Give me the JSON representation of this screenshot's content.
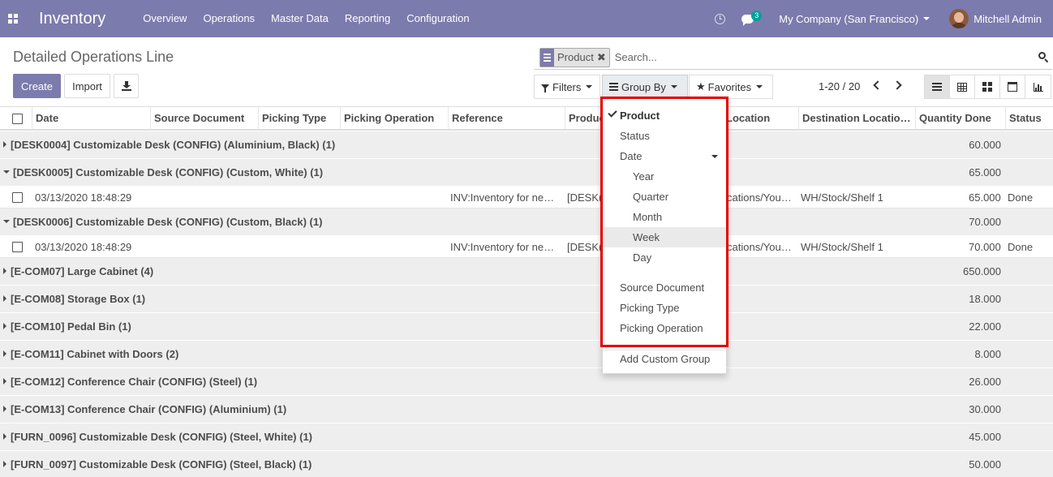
{
  "navbar": {
    "app_title": "Inventory",
    "menu": [
      "Overview",
      "Operations",
      "Master Data",
      "Reporting",
      "Configuration"
    ],
    "chat_badge": "3",
    "company": "My Company (San Francisco)",
    "user": "Mitchell Admin"
  },
  "page": {
    "title": "Detailed Operations Line",
    "create_label": "Create",
    "import_label": "Import"
  },
  "search": {
    "facet_label": "Product",
    "facet_close": "✖",
    "placeholder": "Search..."
  },
  "search_buttons": {
    "filters": "Filters",
    "group_by": "Group By",
    "favorites": "Favorites"
  },
  "pager": {
    "text": "1-20 / 20"
  },
  "table": {
    "columns": [
      "Date",
      "Source Document",
      "Picking Type",
      "Picking Operation",
      "Reference",
      "Product",
      "Location",
      "Destination Locatio…",
      "Quantity Done",
      "Status"
    ],
    "groups": [
      {
        "label": "[DESK0004] Customizable Desk (CONFIG) (Aluminium, Black) (1)",
        "qty": "60.000",
        "open": false
      },
      {
        "label": "[DESK0005] Customizable Desk (CONFIG) (Custom, White) (1)",
        "qty": "65.000",
        "open": true,
        "row": {
          "date": "03/13/2020 18:48:29",
          "reference": "INV:Inventory for ne…",
          "product": "[DESK(",
          "location": "cations/You…",
          "destination": "WH/Stock/Shelf 1",
          "qty": "65.000",
          "status": "Done"
        }
      },
      {
        "label": "[DESK0006] Customizable Desk (CONFIG) (Custom, Black) (1)",
        "qty": "70.000",
        "open": true,
        "row": {
          "date": "03/13/2020 18:48:29",
          "reference": "INV:Inventory for ne…",
          "product": "[DESK(",
          "location": "cations/You…",
          "destination": "WH/Stock/Shelf 1",
          "qty": "70.000",
          "status": "Done"
        }
      },
      {
        "label": "[E-COM07] Large Cabinet (4)",
        "qty": "650.000",
        "open": false
      },
      {
        "label": "[E-COM08] Storage Box (1)",
        "qty": "18.000",
        "open": false
      },
      {
        "label": "[E-COM10] Pedal Bin (1)",
        "qty": "22.000",
        "open": false
      },
      {
        "label": "[E-COM11] Cabinet with Doors (2)",
        "qty": "8.000",
        "open": false
      },
      {
        "label": "[E-COM12] Conference Chair (CONFIG) (Steel) (1)",
        "qty": "26.000",
        "open": false
      },
      {
        "label": "[E-COM13] Conference Chair (CONFIG) (Aluminium) (1)",
        "qty": "30.000",
        "open": false
      },
      {
        "label": "[FURN_0096] Customizable Desk (CONFIG) (Steel, White) (1)",
        "qty": "45.000",
        "open": false
      },
      {
        "label": "[FURN_0097] Customizable Desk (CONFIG) (Steel, Black) (1)",
        "qty": "50.000",
        "open": false
      }
    ]
  },
  "groupby_menu": {
    "items": [
      {
        "label": "Product",
        "selected": true
      },
      {
        "label": "Status"
      },
      {
        "label": "Date",
        "has_caret": true
      },
      {
        "label": "Year",
        "sub": true
      },
      {
        "label": "Quarter",
        "sub": true
      },
      {
        "label": "Month",
        "sub": true
      },
      {
        "label": "Week",
        "sub": true,
        "hover": true
      },
      {
        "label": "Day",
        "sub": true
      },
      {
        "label": "Source Document"
      },
      {
        "label": "Picking Type"
      },
      {
        "label": "Picking Operation"
      }
    ],
    "custom_group": "Add Custom Group"
  },
  "colors": {
    "brand": "#7c7bad",
    "highlight": "#e60000",
    "badge": "#00a09d"
  }
}
